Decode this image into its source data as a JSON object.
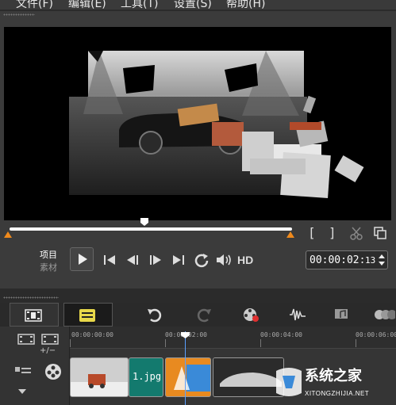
{
  "menu": {
    "items": [
      "文件(F)",
      "编辑(E)",
      "工具(T)",
      "设置(S)",
      "帮助(H)"
    ]
  },
  "player": {
    "mode_project": "项目",
    "mode_clip": "素材",
    "hd_label": "HD",
    "timecode": "00:00:02:",
    "timecode_frame": "13",
    "bracket_in": "[",
    "bracket_out": "]",
    "playhead_progress": 0.48
  },
  "toolbar": {
    "icons": [
      "storyboard-view-icon",
      "timeline-view-icon",
      "undo-icon",
      "redo-icon",
      "record-capture-icon",
      "sound-mixer-icon",
      "auto-music-icon",
      "multi-track-icon"
    ]
  },
  "timeline": {
    "ruler_labels": [
      "00:00:00:00",
      "00:00:02:00",
      "00:00:04:00",
      "00:00:06:00"
    ],
    "add_remove_label": "+/−",
    "clips": [
      {
        "kind": "image",
        "label": ""
      },
      {
        "kind": "image",
        "label": "1.jpg"
      },
      {
        "kind": "transition",
        "label": ""
      },
      {
        "kind": "image",
        "label": ""
      }
    ]
  },
  "watermark": {
    "name": "系统之家",
    "url": "XITONGZHIJIA.NET"
  },
  "colors": {
    "accent_orange": "#f08a1c",
    "clip_teal": "#137a6e",
    "cursor_blue": "#5aa0ff"
  }
}
